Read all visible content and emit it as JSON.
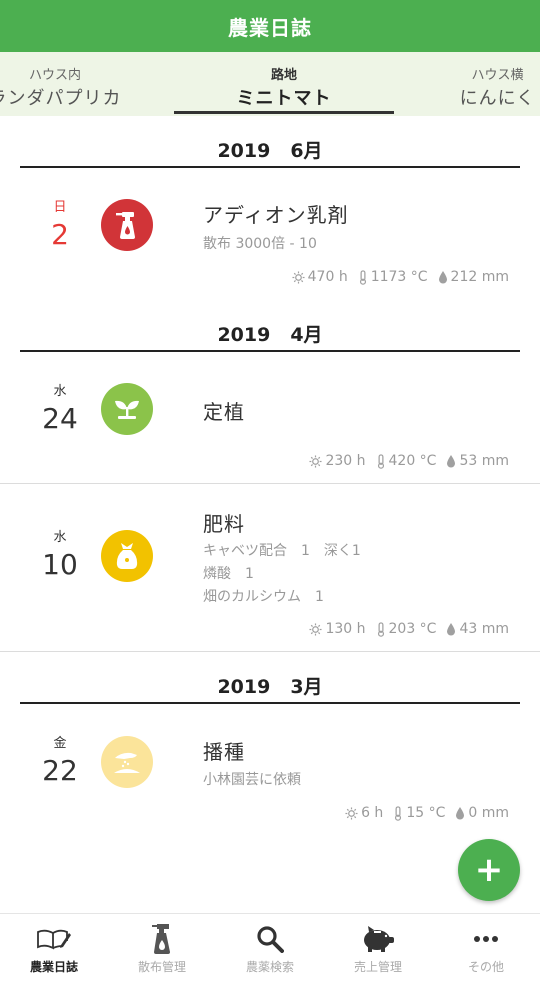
{
  "header": {
    "title": "農業日誌"
  },
  "tabs": [
    {
      "sub": "ハウス内",
      "main": "ランダパプリカ"
    },
    {
      "sub": "路地",
      "main": "ミニトマト"
    },
    {
      "sub": "ハウス横",
      "main": "にんにく"
    }
  ],
  "months": [
    {
      "year": "2019",
      "month": "6月"
    },
    {
      "year": "2019",
      "month": "4月"
    },
    {
      "year": "2019",
      "month": "3月"
    }
  ],
  "entries": [
    {
      "dow": "日",
      "day": "2",
      "title": "アディオン乳剤",
      "details": [
        "散布 3000倍 - 10"
      ],
      "hours": "470 h",
      "temp": "1173 °C",
      "rain": "212 mm",
      "icon": "spray-bottle-icon",
      "color": "#d13438"
    },
    {
      "dow": "水",
      "day": "24",
      "title": "定植",
      "details": [],
      "hours": "230 h",
      "temp": "420 °C",
      "rain": "53 mm",
      "icon": "sprout-icon",
      "color": "#8bc34a"
    },
    {
      "dow": "水",
      "day": "10",
      "title": "肥料",
      "details": [
        "キャベツ配合　1　深く1",
        "燐酸　1",
        "畑のカルシウム　1"
      ],
      "hours": "130 h",
      "temp": "203 °C",
      "rain": "43 mm",
      "icon": "fertilizer-bag-icon",
      "color": "#f2c200"
    },
    {
      "dow": "金",
      "day": "22",
      "title": "播種",
      "details": [
        "小林園芸に依頼"
      ],
      "hours": "6 h",
      "temp": "15 °C",
      "rain": "0 mm",
      "icon": "sowing-hand-icon",
      "color": "#fbe49a"
    }
  ],
  "fab": {
    "label": "+"
  },
  "nav": [
    {
      "label": "農業日誌",
      "icon": "book-pen-icon"
    },
    {
      "label": "散布管理",
      "icon": "spray-bottle-icon"
    },
    {
      "label": "農薬検索",
      "icon": "search-icon"
    },
    {
      "label": "売上管理",
      "icon": "piggy-bank-icon"
    },
    {
      "label": "その他",
      "icon": "more-dots-icon"
    }
  ]
}
